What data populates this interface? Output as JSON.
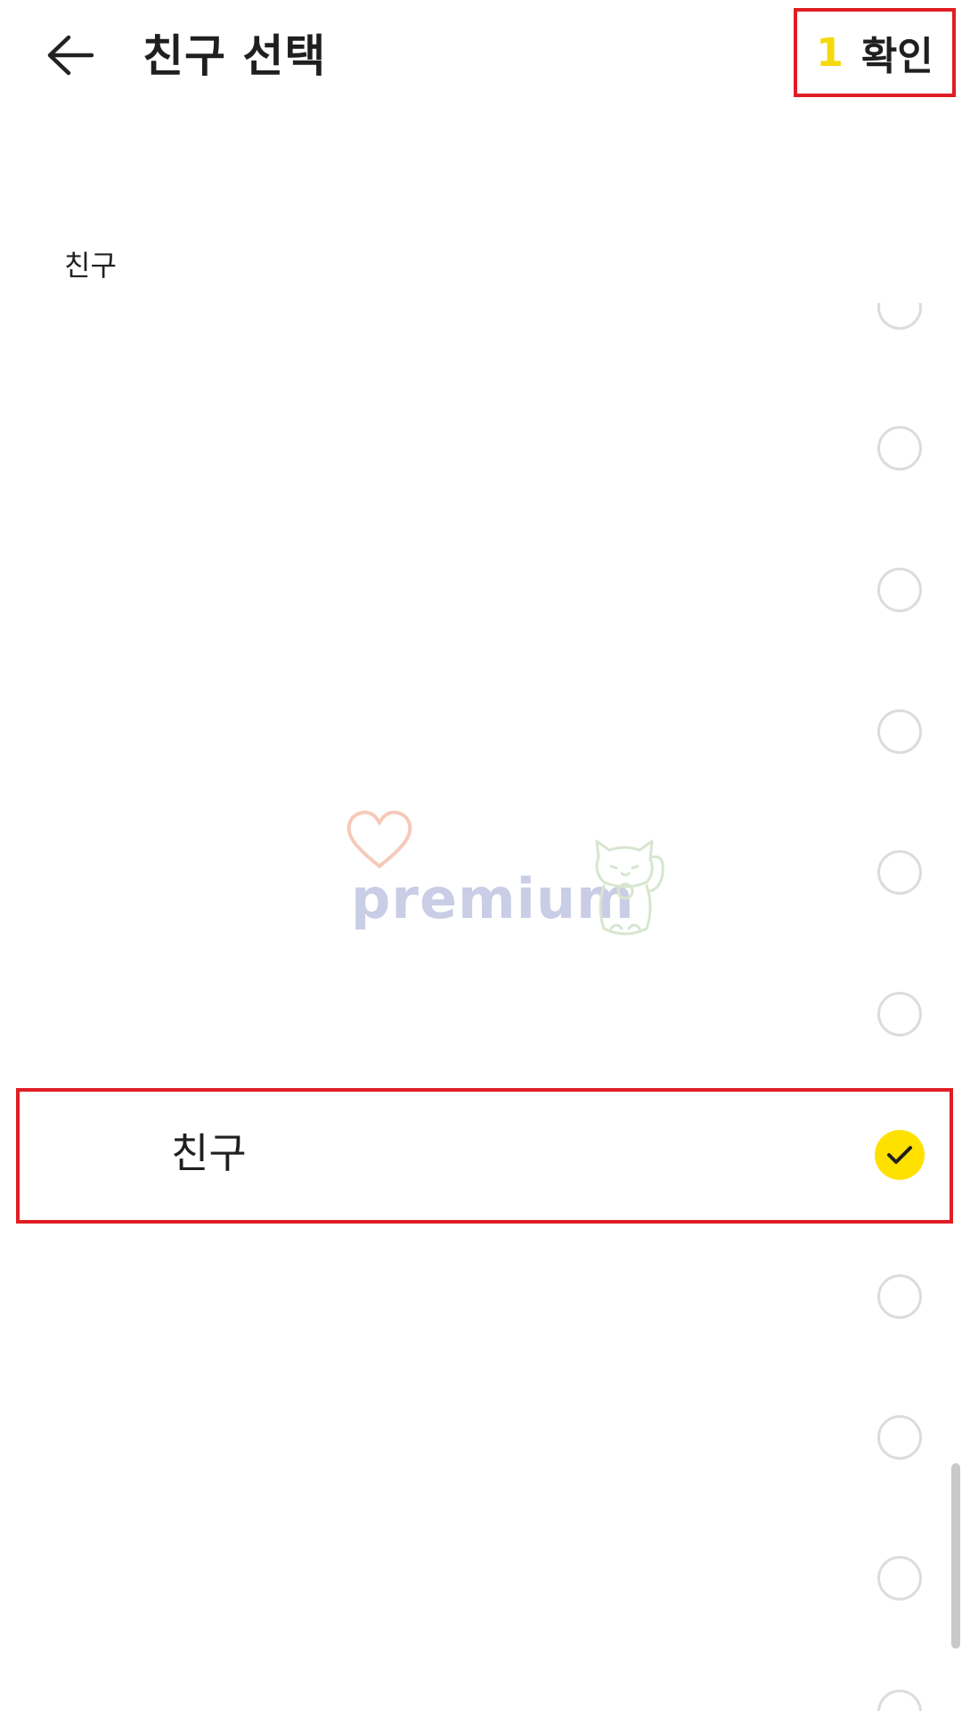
{
  "header": {
    "title": "친구 선택",
    "confirm_count": "1",
    "confirm_label": "확인"
  },
  "section": {
    "label": "친구"
  },
  "list": {
    "selected_name": "친구",
    "selected_index": 6,
    "row_count": 10
  },
  "watermark": {
    "text": "premium"
  },
  "colors": {
    "accent_yellow": "#ffe100",
    "highlight_red": "#e01e24",
    "radio_border": "#dcdcdc"
  },
  "icons": {
    "back": "arrow-left-icon",
    "check": "checkmark-icon"
  }
}
